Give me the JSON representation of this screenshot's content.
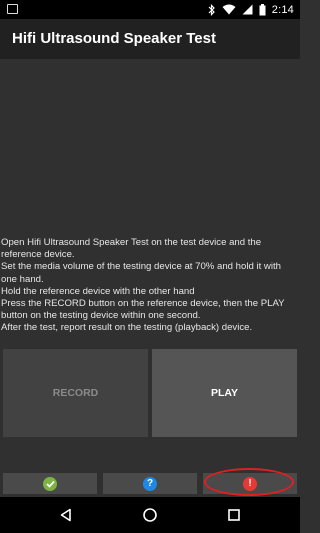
{
  "status_bar": {
    "time": "2:14",
    "icons": [
      "notification-icon",
      "bluetooth-icon",
      "wifi-icon",
      "cellular-icon",
      "battery-icon"
    ]
  },
  "app_bar": {
    "title": "Hifi Ultrasound Speaker Test"
  },
  "instructions": {
    "lines": [
      "Open Hifi Ultrasound Speaker Test on the test device and the reference device.",
      " Set the media volume of the testing device at 70% and hold it with one hand.",
      " Hold the reference device with the other hand",
      " Press the RECORD button on the reference device, then the PLAY button on the testing device within one second.",
      " After the test, report result on the testing (playback) device."
    ]
  },
  "buttons": {
    "record": "RECORD",
    "play": "PLAY"
  },
  "result_buttons": {
    "pass_icon": "check-icon",
    "info_icon": "question-icon",
    "fail_icon": "exclamation-icon",
    "info_glyph": "?",
    "fail_glyph": "!"
  },
  "colors": {
    "pass": "#7cb342",
    "info": "#1e88e5",
    "fail": "#e53935",
    "highlight": "#e02020"
  },
  "nav_bar": {
    "icons": [
      "back-icon",
      "home-icon",
      "recents-icon"
    ]
  }
}
